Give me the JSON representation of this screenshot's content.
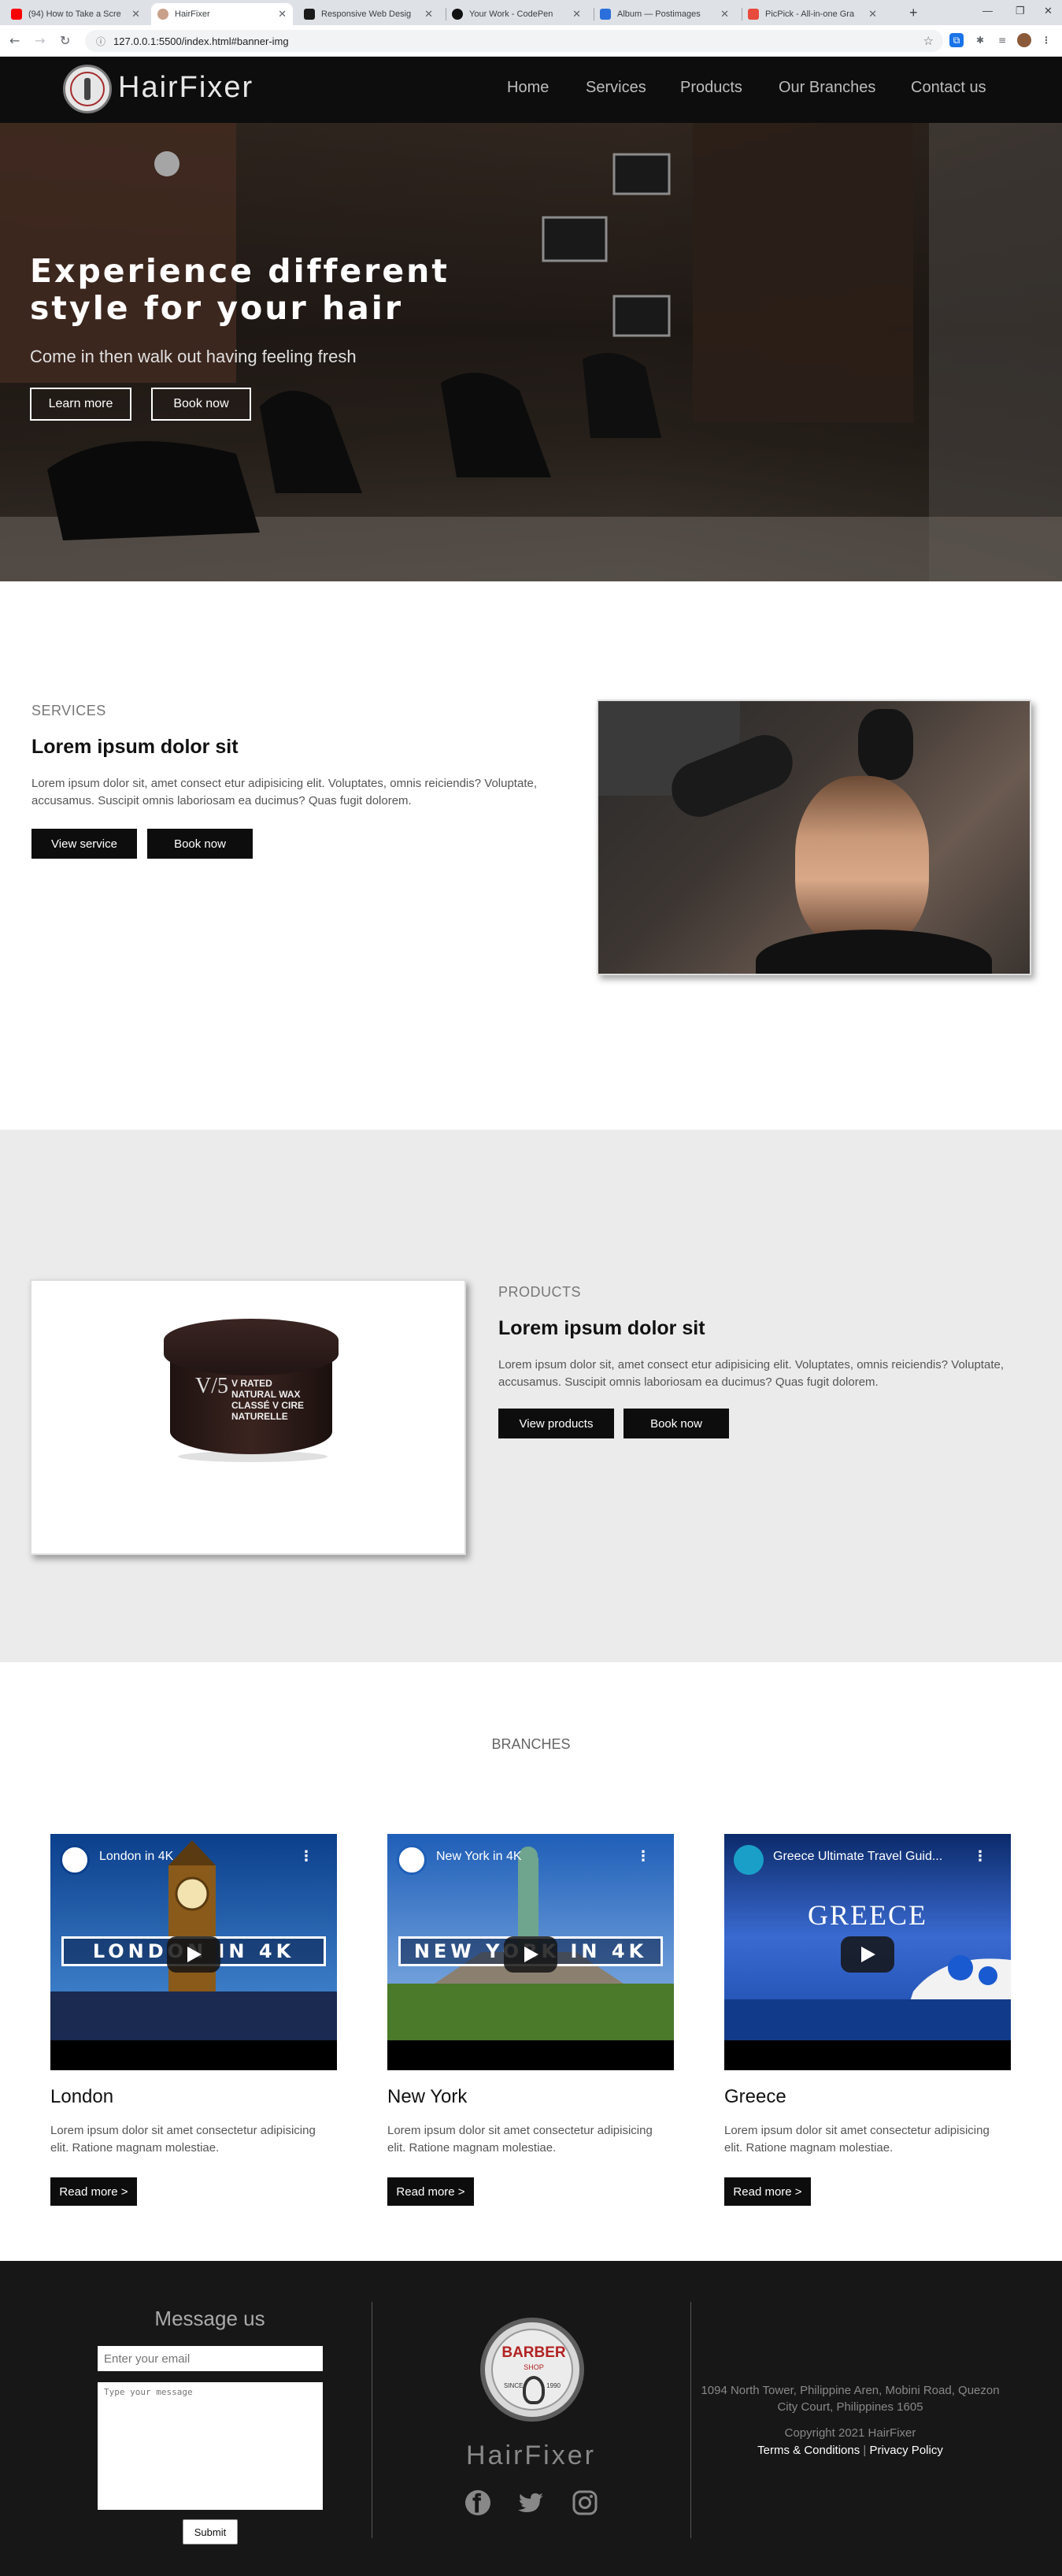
{
  "browser": {
    "tabs": [
      {
        "label": "(94) How to Take a Scre",
        "favicon_color": "#ff0000"
      },
      {
        "label": "HairFixer",
        "favicon_color": "#c9a08a",
        "active": true
      },
      {
        "label": "Responsive Web Desig",
        "favicon_color": "#1a1a1a"
      },
      {
        "label": "Your Work - CodePen",
        "favicon_color": "#111111"
      },
      {
        "label": "Album — Postimages",
        "favicon_color": "#2a6fdb"
      },
      {
        "label": "PicPick - All-in-one Gra",
        "favicon_color": "#e84a3c"
      }
    ],
    "url": "127.0.0.1:5500/index.html#banner-img"
  },
  "header": {
    "logo_text": "HairFixer",
    "nav": [
      "Home",
      "Services",
      "Products",
      "Our Branches",
      "Contact us"
    ]
  },
  "hero": {
    "title": "Experience different style for your hair",
    "subtitle": "Come in then walk out having feeling fresh",
    "learn_more": "Learn more",
    "book_now": "Book now"
  },
  "services": {
    "kicker": "SERVICES",
    "title": "Lorem ipsum dolor sit",
    "body": "Lorem ipsum dolor sit, amet consect etur adipisicing elit. Voluptates, omnis reiciendis? Voluptate, accusamus. Suscipit omnis laboriosam ea ducimus? Quas fugit dolorem.",
    "view_button": "View service",
    "book_button": "Book now"
  },
  "products": {
    "kicker": "PRODUCTS",
    "title": "Lorem ipsum dolor sit",
    "body": "Lorem ipsum dolor sit, amet consect etur adipisicing elit. Voluptates, omnis reiciendis? Voluptate, accusamus. Suscipit omnis laboriosam ea ducimus? Quas fugit dolorem.",
    "view_button": "View products",
    "book_button": "Book now",
    "jar_label": "V RATED NATURAL WAX CLASSÉ V CIRE NATURELLE",
    "jar_logo": "V/5"
  },
  "branches": {
    "kicker": "BRANCHES",
    "items": [
      {
        "name": "London",
        "video_title": "London in 4K",
        "banner": "LONDON IN 4K",
        "text": "Lorem ipsum dolor sit amet consectetur adipisicing elit. Ratione magnam molestiae.",
        "button": "Read more >"
      },
      {
        "name": "New York",
        "video_title": "New York in 4K",
        "banner": "NEW YORK IN 4K",
        "text": "Lorem ipsum dolor sit amet consectetur adipisicing elit. Ratione magnam molestiae.",
        "button": "Read more >"
      },
      {
        "name": "Greece",
        "video_title": "Greece Ultimate Travel Guid...",
        "banner": "GREECE",
        "text": "Lorem ipsum dolor sit amet consectetur adipisicing elit. Ratione magnam molestiae.",
        "button": "Read more >"
      }
    ]
  },
  "footer": {
    "message_title": "Message us",
    "email_placeholder": "Enter your email",
    "message_placeholder": "Type your message",
    "submit": "Submit",
    "logo_word": "BARBER",
    "logo_shop": "SHOP",
    "logo_since": "SINCE",
    "logo_year": "1990",
    "brand": "HairFixer",
    "address": "1094 North Tower, Philippine Aren, Mobini Road, Quezon City Court, Philippines 1605",
    "copyright": "Copyright 2021 HairFixer",
    "terms": "Terms & Conditions",
    "separator": "|",
    "privacy": "Privacy Policy",
    "social_icons": [
      "facebook-icon",
      "twitter-icon",
      "instagram-icon"
    ]
  }
}
